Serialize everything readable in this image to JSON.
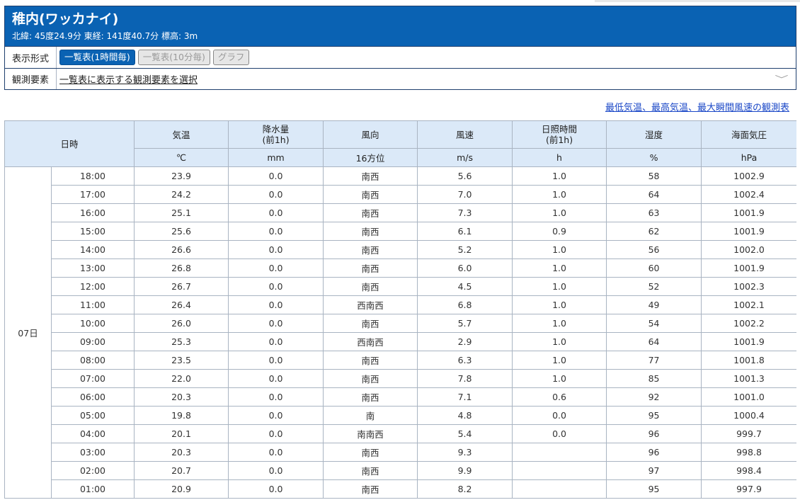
{
  "station": {
    "name": "稚内(ワッカナイ)",
    "meta": "北緯: 45度24.9分 東経: 141度40.7分 標高: 3m"
  },
  "display_format": {
    "label": "表示形式",
    "buttons": [
      "一覧表(1時間毎)",
      "一覧表(10分毎)",
      "グラフ"
    ],
    "active": "一覧表(1時間毎)"
  },
  "elements": {
    "label": "観測要素",
    "select_text": "一覧表に表示する観測要素を選択",
    "chevron": "chevron-down-icon"
  },
  "link": "最低気温、最高気温、最大瞬間風速の観測表",
  "table": {
    "datetime_header": "日時",
    "headers": [
      "気温",
      "降水量\n(前1h)",
      "風向",
      "風速",
      "日照時間\n(前1h)",
      "湿度",
      "海面気圧"
    ],
    "units": [
      "℃",
      "mm",
      "16方位",
      "m/s",
      "h",
      "%",
      "hPa"
    ],
    "day": "07日",
    "rows": [
      [
        "18:00",
        "23.9",
        "0.0",
        "南西",
        "5.6",
        "1.0",
        "58",
        "1002.9"
      ],
      [
        "17:00",
        "24.2",
        "0.0",
        "南西",
        "7.0",
        "1.0",
        "64",
        "1002.4"
      ],
      [
        "16:00",
        "25.1",
        "0.0",
        "南西",
        "7.3",
        "1.0",
        "63",
        "1001.9"
      ],
      [
        "15:00",
        "25.6",
        "0.0",
        "南西",
        "6.1",
        "0.9",
        "62",
        "1001.9"
      ],
      [
        "14:00",
        "26.6",
        "0.0",
        "南西",
        "5.2",
        "1.0",
        "56",
        "1002.0"
      ],
      [
        "13:00",
        "26.8",
        "0.0",
        "南西",
        "6.0",
        "1.0",
        "60",
        "1001.9"
      ],
      [
        "12:00",
        "26.7",
        "0.0",
        "南西",
        "4.5",
        "1.0",
        "52",
        "1002.3"
      ],
      [
        "11:00",
        "26.4",
        "0.0",
        "西南西",
        "6.8",
        "1.0",
        "49",
        "1002.1"
      ],
      [
        "10:00",
        "26.0",
        "0.0",
        "南西",
        "5.7",
        "1.0",
        "54",
        "1002.2"
      ],
      [
        "09:00",
        "25.3",
        "0.0",
        "西南西",
        "2.9",
        "1.0",
        "64",
        "1001.9"
      ],
      [
        "08:00",
        "23.5",
        "0.0",
        "南西",
        "6.3",
        "1.0",
        "77",
        "1001.8"
      ],
      [
        "07:00",
        "22.0",
        "0.0",
        "南西",
        "7.8",
        "1.0",
        "85",
        "1001.3"
      ],
      [
        "06:00",
        "20.3",
        "0.0",
        "南西",
        "7.1",
        "0.6",
        "92",
        "1001.0"
      ],
      [
        "05:00",
        "19.8",
        "0.0",
        "南",
        "4.8",
        "0.0",
        "95",
        "1000.4"
      ],
      [
        "04:00",
        "20.1",
        "0.0",
        "南南西",
        "5.4",
        "0.0",
        "96",
        "999.7"
      ],
      [
        "03:00",
        "20.3",
        "0.0",
        "南西",
        "9.3",
        "",
        "96",
        "998.8"
      ],
      [
        "02:00",
        "20.7",
        "0.0",
        "南西",
        "9.9",
        "",
        "97",
        "998.4"
      ],
      [
        "01:00",
        "20.9",
        "0.0",
        "南西",
        "8.2",
        "",
        "95",
        "997.9"
      ]
    ]
  },
  "colors": {
    "header_blue": "#0a62b3",
    "table_head_bg": "#dbe9f8",
    "link": "#1a47c7"
  }
}
